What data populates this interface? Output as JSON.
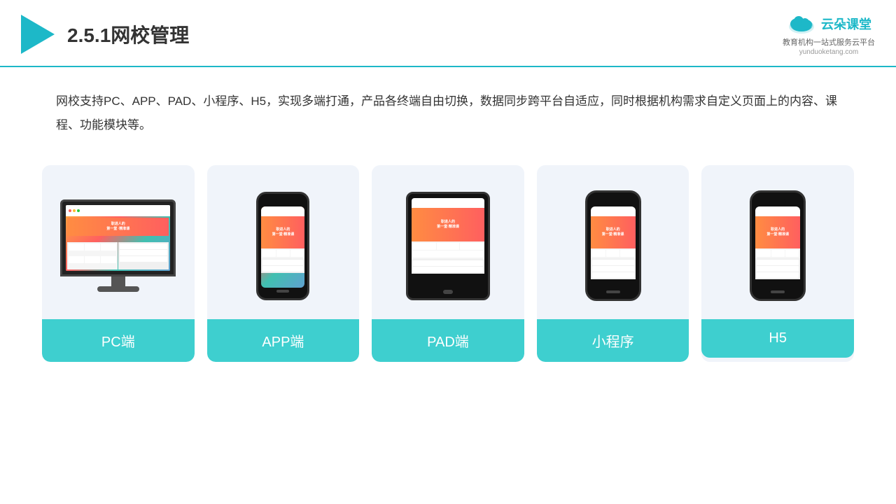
{
  "header": {
    "title": "2.5.1网校管理",
    "logo_text": "云朵课堂",
    "logo_url": "yunduoketang.com",
    "logo_sub": "教育机构一站式服务云平台"
  },
  "description": "网校支持PC、APP、PAD、小程序、H5，实现多端打通，产品各终端自由切换，数据同步跨平台自适应，同时根据机构需求自定义页面上的内容、课程、功能模块等。",
  "cards": [
    {
      "id": "pc",
      "label": "PC端"
    },
    {
      "id": "app",
      "label": "APP端"
    },
    {
      "id": "pad",
      "label": "PAD端"
    },
    {
      "id": "miniprogram",
      "label": "小程序"
    },
    {
      "id": "h5",
      "label": "H5"
    }
  ]
}
